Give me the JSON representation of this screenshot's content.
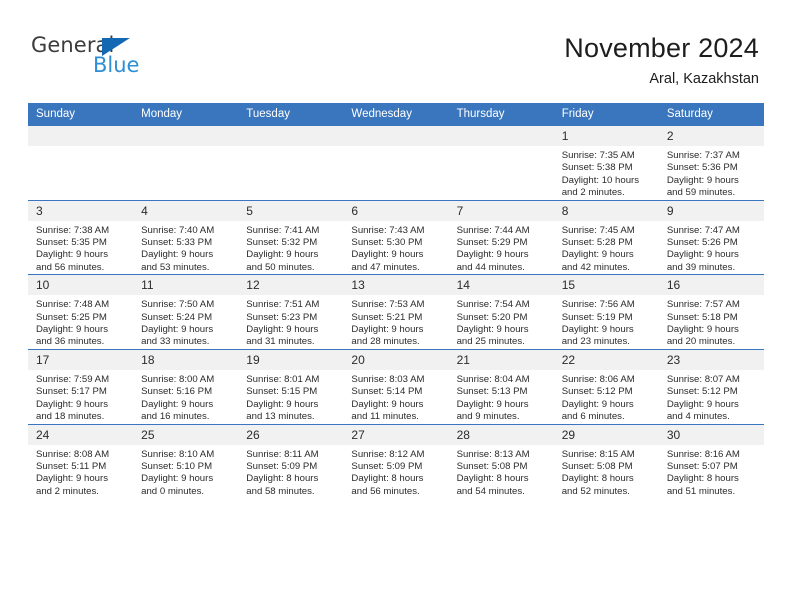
{
  "brand": {
    "name_part1": "General",
    "name_part2": "Blue",
    "accent_color": "#2e8fd4",
    "triangle_color": "#1268b3",
    "triangle_icon": "triangle-icon"
  },
  "header": {
    "title": "November 2024",
    "subtitle": "Aral, Kazakhstan"
  },
  "theme": {
    "header_blue": "#3a76bd",
    "daynum_strip": "#f1f1f1",
    "text": "#2b2b2b"
  },
  "calendar": {
    "weekday_headers": [
      "Sunday",
      "Monday",
      "Tuesday",
      "Wednesday",
      "Thursday",
      "Friday",
      "Saturday"
    ],
    "weeks": [
      [
        {
          "day": "",
          "empty": true
        },
        {
          "day": "",
          "empty": true
        },
        {
          "day": "",
          "empty": true
        },
        {
          "day": "",
          "empty": true
        },
        {
          "day": "",
          "empty": true
        },
        {
          "day": "1",
          "sunrise": "Sunrise: 7:35 AM",
          "sunset": "Sunset: 5:38 PM",
          "daylight_1": "Daylight: 10 hours",
          "daylight_2": "and 2 minutes."
        },
        {
          "day": "2",
          "sunrise": "Sunrise: 7:37 AM",
          "sunset": "Sunset: 5:36 PM",
          "daylight_1": "Daylight: 9 hours",
          "daylight_2": "and 59 minutes."
        }
      ],
      [
        {
          "day": "3",
          "sunrise": "Sunrise: 7:38 AM",
          "sunset": "Sunset: 5:35 PM",
          "daylight_1": "Daylight: 9 hours",
          "daylight_2": "and 56 minutes."
        },
        {
          "day": "4",
          "sunrise": "Sunrise: 7:40 AM",
          "sunset": "Sunset: 5:33 PM",
          "daylight_1": "Daylight: 9 hours",
          "daylight_2": "and 53 minutes."
        },
        {
          "day": "5",
          "sunrise": "Sunrise: 7:41 AM",
          "sunset": "Sunset: 5:32 PM",
          "daylight_1": "Daylight: 9 hours",
          "daylight_2": "and 50 minutes."
        },
        {
          "day": "6",
          "sunrise": "Sunrise: 7:43 AM",
          "sunset": "Sunset: 5:30 PM",
          "daylight_1": "Daylight: 9 hours",
          "daylight_2": "and 47 minutes."
        },
        {
          "day": "7",
          "sunrise": "Sunrise: 7:44 AM",
          "sunset": "Sunset: 5:29 PM",
          "daylight_1": "Daylight: 9 hours",
          "daylight_2": "and 44 minutes."
        },
        {
          "day": "8",
          "sunrise": "Sunrise: 7:45 AM",
          "sunset": "Sunset: 5:28 PM",
          "daylight_1": "Daylight: 9 hours",
          "daylight_2": "and 42 minutes."
        },
        {
          "day": "9",
          "sunrise": "Sunrise: 7:47 AM",
          "sunset": "Sunset: 5:26 PM",
          "daylight_1": "Daylight: 9 hours",
          "daylight_2": "and 39 minutes."
        }
      ],
      [
        {
          "day": "10",
          "sunrise": "Sunrise: 7:48 AM",
          "sunset": "Sunset: 5:25 PM",
          "daylight_1": "Daylight: 9 hours",
          "daylight_2": "and 36 minutes."
        },
        {
          "day": "11",
          "sunrise": "Sunrise: 7:50 AM",
          "sunset": "Sunset: 5:24 PM",
          "daylight_1": "Daylight: 9 hours",
          "daylight_2": "and 33 minutes."
        },
        {
          "day": "12",
          "sunrise": "Sunrise: 7:51 AM",
          "sunset": "Sunset: 5:23 PM",
          "daylight_1": "Daylight: 9 hours",
          "daylight_2": "and 31 minutes."
        },
        {
          "day": "13",
          "sunrise": "Sunrise: 7:53 AM",
          "sunset": "Sunset: 5:21 PM",
          "daylight_1": "Daylight: 9 hours",
          "daylight_2": "and 28 minutes."
        },
        {
          "day": "14",
          "sunrise": "Sunrise: 7:54 AM",
          "sunset": "Sunset: 5:20 PM",
          "daylight_1": "Daylight: 9 hours",
          "daylight_2": "and 25 minutes."
        },
        {
          "day": "15",
          "sunrise": "Sunrise: 7:56 AM",
          "sunset": "Sunset: 5:19 PM",
          "daylight_1": "Daylight: 9 hours",
          "daylight_2": "and 23 minutes."
        },
        {
          "day": "16",
          "sunrise": "Sunrise: 7:57 AM",
          "sunset": "Sunset: 5:18 PM",
          "daylight_1": "Daylight: 9 hours",
          "daylight_2": "and 20 minutes."
        }
      ],
      [
        {
          "day": "17",
          "sunrise": "Sunrise: 7:59 AM",
          "sunset": "Sunset: 5:17 PM",
          "daylight_1": "Daylight: 9 hours",
          "daylight_2": "and 18 minutes."
        },
        {
          "day": "18",
          "sunrise": "Sunrise: 8:00 AM",
          "sunset": "Sunset: 5:16 PM",
          "daylight_1": "Daylight: 9 hours",
          "daylight_2": "and 16 minutes."
        },
        {
          "day": "19",
          "sunrise": "Sunrise: 8:01 AM",
          "sunset": "Sunset: 5:15 PM",
          "daylight_1": "Daylight: 9 hours",
          "daylight_2": "and 13 minutes."
        },
        {
          "day": "20",
          "sunrise": "Sunrise: 8:03 AM",
          "sunset": "Sunset: 5:14 PM",
          "daylight_1": "Daylight: 9 hours",
          "daylight_2": "and 11 minutes."
        },
        {
          "day": "21",
          "sunrise": "Sunrise: 8:04 AM",
          "sunset": "Sunset: 5:13 PM",
          "daylight_1": "Daylight: 9 hours",
          "daylight_2": "and 9 minutes."
        },
        {
          "day": "22",
          "sunrise": "Sunrise: 8:06 AM",
          "sunset": "Sunset: 5:12 PM",
          "daylight_1": "Daylight: 9 hours",
          "daylight_2": "and 6 minutes."
        },
        {
          "day": "23",
          "sunrise": "Sunrise: 8:07 AM",
          "sunset": "Sunset: 5:12 PM",
          "daylight_1": "Daylight: 9 hours",
          "daylight_2": "and 4 minutes."
        }
      ],
      [
        {
          "day": "24",
          "sunrise": "Sunrise: 8:08 AM",
          "sunset": "Sunset: 5:11 PM",
          "daylight_1": "Daylight: 9 hours",
          "daylight_2": "and 2 minutes."
        },
        {
          "day": "25",
          "sunrise": "Sunrise: 8:10 AM",
          "sunset": "Sunset: 5:10 PM",
          "daylight_1": "Daylight: 9 hours",
          "daylight_2": "and 0 minutes."
        },
        {
          "day": "26",
          "sunrise": "Sunrise: 8:11 AM",
          "sunset": "Sunset: 5:09 PM",
          "daylight_1": "Daylight: 8 hours",
          "daylight_2": "and 58 minutes."
        },
        {
          "day": "27",
          "sunrise": "Sunrise: 8:12 AM",
          "sunset": "Sunset: 5:09 PM",
          "daylight_1": "Daylight: 8 hours",
          "daylight_2": "and 56 minutes."
        },
        {
          "day": "28",
          "sunrise": "Sunrise: 8:13 AM",
          "sunset": "Sunset: 5:08 PM",
          "daylight_1": "Daylight: 8 hours",
          "daylight_2": "and 54 minutes."
        },
        {
          "day": "29",
          "sunrise": "Sunrise: 8:15 AM",
          "sunset": "Sunset: 5:08 PM",
          "daylight_1": "Daylight: 8 hours",
          "daylight_2": "and 52 minutes."
        },
        {
          "day": "30",
          "sunrise": "Sunrise: 8:16 AM",
          "sunset": "Sunset: 5:07 PM",
          "daylight_1": "Daylight: 8 hours",
          "daylight_2": "and 51 minutes."
        }
      ]
    ]
  }
}
